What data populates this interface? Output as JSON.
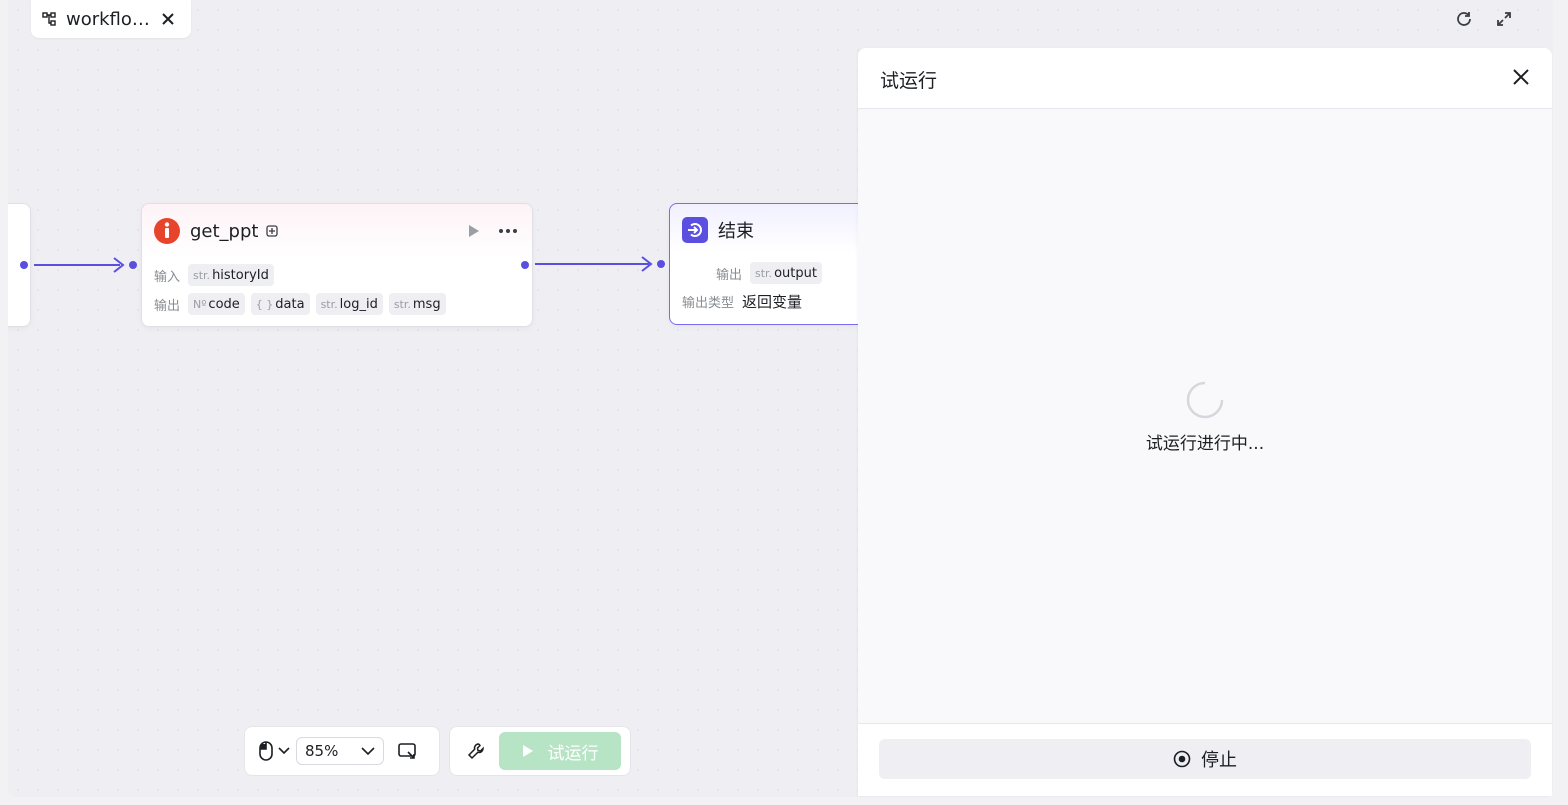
{
  "tab": {
    "title": "workflo…"
  },
  "nodes": {
    "get_ppt": {
      "title": "get_ppt",
      "input_label": "输入",
      "output_label": "输出",
      "inputs": [
        {
          "type": "str.",
          "name": "historyId"
        }
      ],
      "outputs": [
        {
          "type": "Nº",
          "name": "code"
        },
        {
          "type": "{ }",
          "name": "data"
        },
        {
          "type": "str.",
          "name": "log_id"
        },
        {
          "type": "str.",
          "name": "msg"
        }
      ]
    },
    "end": {
      "title": "结束",
      "output_label": "输出",
      "output_type_label": "输出类型",
      "outputs": [
        {
          "type": "str.",
          "name": "output"
        }
      ],
      "output_type_value": "返回变量"
    }
  },
  "panel": {
    "title": "试运行",
    "status_text": "试运行进行中...",
    "stop_label": "停止"
  },
  "toolbar": {
    "zoom": "85%",
    "trial_run_label": "试运行"
  },
  "colors": {
    "accent": "#5a4fe0",
    "trial_button_bg": "#b7e4c4",
    "plugin_icon": "#e8432b"
  }
}
